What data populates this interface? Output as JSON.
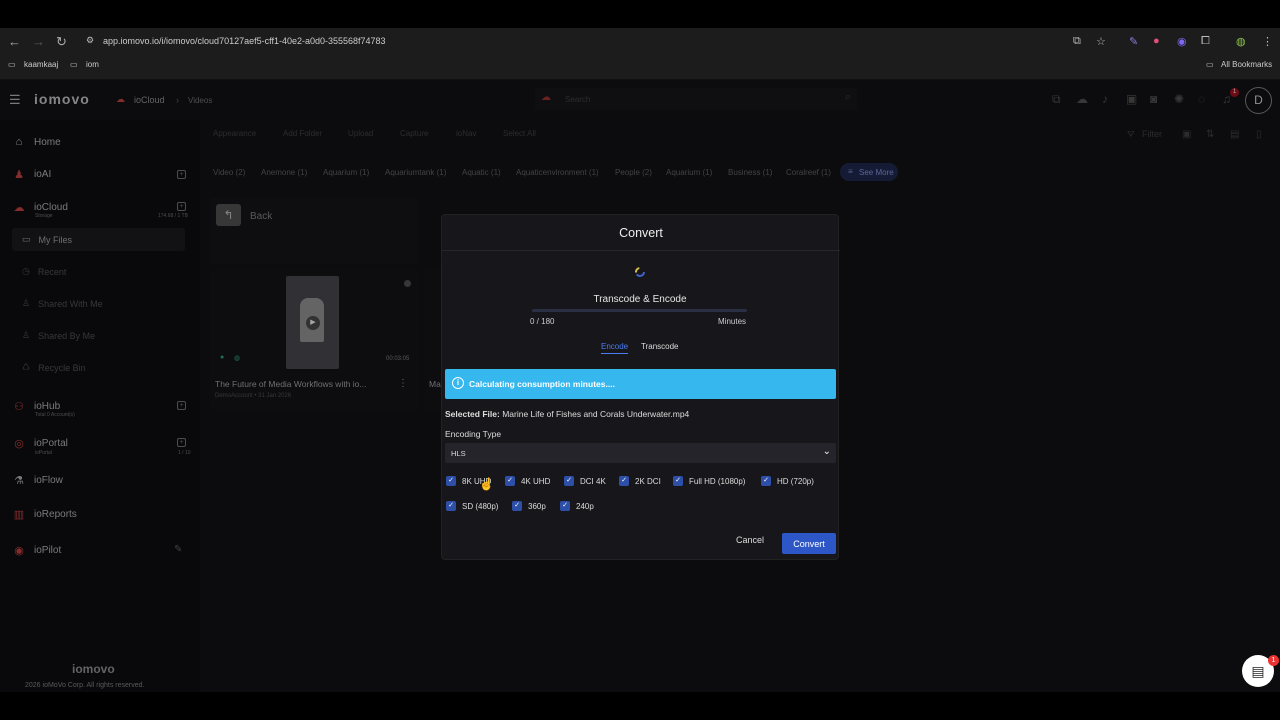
{
  "browser": {
    "url": "app.iomovo.io/i/iomovo/cloud70127aef5-cff1-40e2-a0d0-355568f74783",
    "bookmarks": [
      "kaamkaaj",
      "iom"
    ],
    "all_bookmarks": "All Bookmarks",
    "profile_initial": "D"
  },
  "app": {
    "logo": "iomovo",
    "breadcrumb": [
      "ioCloud",
      "Videos"
    ],
    "search_placeholder": "Search",
    "notification_count": "1",
    "toolbar": [
      "Appearance",
      "Add Folder",
      "Upload",
      "Capture",
      "ioNav",
      "Select All"
    ],
    "filter_label": "Filter",
    "chips": [
      "Video (2)",
      "Anemone (1)",
      "Aquarium (1)",
      "Aquariumtank (1)",
      "Aquatic (1)",
      "Aquaticenvironment (1)",
      "People (2)",
      "Aquarium (1)",
      "Business (1)",
      "Coralreef (1)"
    ],
    "see_more": "See More",
    "back_label": "Back",
    "card": {
      "duration": "00:03:05",
      "title": "The Future of Media Workflows with io...",
      "meta": "DemoAccount • 31 Jan 2026"
    },
    "next_card_title": "Ma",
    "sidebar": {
      "items": [
        {
          "label": "Home",
          "sub": ""
        },
        {
          "label": "ioAI",
          "sub": ""
        },
        {
          "label": "ioCloud",
          "sub": "Storage"
        },
        {
          "label": "ioHub",
          "sub": "Total 0 Account(s)"
        },
        {
          "label": "ioPortal",
          "sub": "ioPortal"
        },
        {
          "label": "ioFlow",
          "sub": ""
        },
        {
          "label": "ioReports",
          "sub": ""
        },
        {
          "label": "ioPilot",
          "sub": ""
        }
      ],
      "storage": "174.68 / 1 TB",
      "portal_usage": "1 / 10",
      "subitems": [
        "My Files",
        "Recent",
        "Shared With Me",
        "Shared By Me",
        "Recycle Bin"
      ]
    },
    "footer_copyright": "2026 ioMoVo Corp. All rights reserved.",
    "chat_badge": "1"
  },
  "modal": {
    "title": "Convert",
    "status_title": "Transcode & Encode",
    "progress_count": "0 / 180",
    "progress_unit": "Minutes",
    "progress_fraction": 0.0,
    "tabs": [
      "Encode",
      "Transcode"
    ],
    "active_tab": "Encode",
    "info_message": "Calculating consumption minutes....",
    "selected_file_label": "Selected File:",
    "selected_file_name": "Marine Life of Fishes and Corals Underwater.mp4",
    "encoding_type_label": "Encoding Type",
    "encoding_type_value": "HLS",
    "resolutions": [
      {
        "label": "8K UHD",
        "checked": true
      },
      {
        "label": "4K UHD",
        "checked": true
      },
      {
        "label": "DCI 4K",
        "checked": true
      },
      {
        "label": "2K DCI",
        "checked": true
      },
      {
        "label": "Full HD (1080p)",
        "checked": true
      },
      {
        "label": "HD (720p)",
        "checked": true
      },
      {
        "label": "SD (480p)",
        "checked": true
      },
      {
        "label": "360p",
        "checked": true
      },
      {
        "label": "240p",
        "checked": true
      }
    ],
    "cancel_label": "Cancel",
    "convert_label": "Convert",
    "accent_color": "#2d57c7",
    "info_color": "#36b7ee"
  }
}
